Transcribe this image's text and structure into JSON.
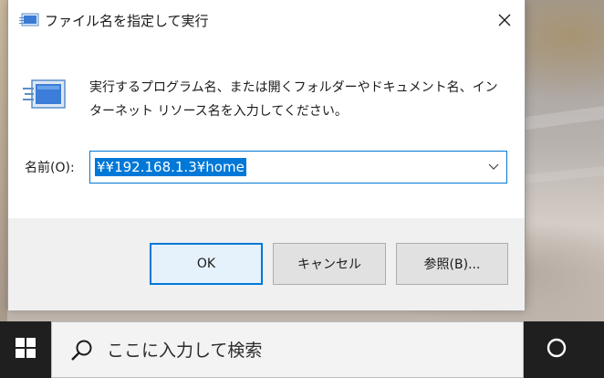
{
  "dialog": {
    "title": "ファイル名を指定して実行",
    "description_line1": "実行するプログラム名、または開くフォルダーやドキュメント名、イン",
    "description_line2": "ターネット リソース名を入力してください。",
    "name_label": "名前(O):",
    "name_value": "¥¥192.168.1.3¥home",
    "buttons": {
      "ok": "OK",
      "cancel": "キャンセル",
      "browse": "参照(B)..."
    },
    "icons": {
      "title": "run-icon",
      "main": "run-icon",
      "close": "close-icon",
      "dropdown": "chevron-down-icon"
    }
  },
  "taskbar": {
    "search_placeholder": "ここに入力して検索",
    "icons": {
      "start": "windows-logo-icon",
      "search": "search-icon",
      "cortana": "cortana-circle-icon"
    }
  },
  "colors": {
    "accent": "#0078d7",
    "taskbar": "#1f1f1f",
    "dialog_footer": "#f0f0f0"
  }
}
